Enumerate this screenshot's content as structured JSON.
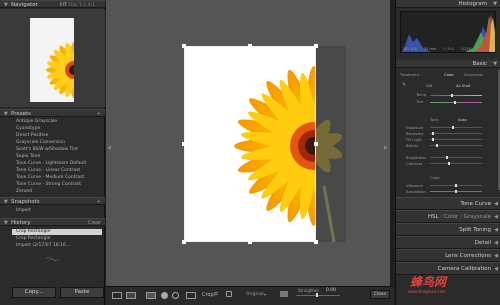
{
  "navigator": {
    "title": "Navigator",
    "zoom_options": [
      "FIT",
      "FILL",
      "1:1",
      "4:1"
    ]
  },
  "presets": {
    "title": "Presets",
    "items": [
      "Antique Grayscale",
      "Cyanotype",
      "Direct Positive",
      "Grayscale Conversion",
      "Scott's B&W w/Shadow Tint",
      "Sepia Tone",
      "Tone Curve - Lightroom Default",
      "Tone Curve - Linear Contrast",
      "Tone Curve - Medium Contrast",
      "Tone Curve - Strong Contrast",
      "Zeroed"
    ]
  },
  "snapshots": {
    "title": "Snapshots",
    "items": [
      "Import"
    ]
  },
  "history": {
    "title": "History",
    "clear_label": "Clear",
    "items": [
      "Crop Rectangle",
      "Crop Rectangle",
      "Import (2/17/07 16:16..."
    ]
  },
  "buttons": {
    "copy": "Copy...",
    "paste": "Paste",
    "close": "Close"
  },
  "toolbar": {
    "crop_label": "Crop:",
    "aspect_value": "Original",
    "straighten_label": "Straighten",
    "angle_value": "0.00"
  },
  "histogram": {
    "title": "Histogram",
    "info": [
      "ISO 100",
      "35 mm",
      "f / 5.0",
      "1/125"
    ]
  },
  "basic": {
    "title": "Basic",
    "treatment_label": "Treatment :",
    "color_option": "Color",
    "grayscale_option": "Grayscale",
    "wb_label": "WB :",
    "wb_value": "As Shot",
    "temp_label": "Temp",
    "tint_label": "Tint",
    "tone_label": "Tone",
    "auto_label": "Auto",
    "exposure_label": "Exposure",
    "recovery_label": "Recovery",
    "fill_light_label": "Fill Light",
    "blacks_label": "Blacks",
    "brightness_label": "Brightness",
    "contrast_label": "Contrast",
    "presence_label": "Color",
    "vibrance_label": "Vibrance",
    "saturation_label": "Saturation"
  },
  "panels": {
    "tone_curve": "Tone Curve",
    "hsl": "HSL",
    "color": "Color",
    "grayscale": "Grayscale",
    "split_toning": "Split Toning",
    "detail": "Detail",
    "lens_corrections": "Lens Corrections",
    "camera_calibration": "Camera Calibration"
  },
  "watermark": {
    "text": "蜂鸟网",
    "url": "www.fengniao.com"
  },
  "colors": {
    "panel_bg": "#2b2b2b",
    "canvas_bg": "#555555",
    "petal": "#f5b400",
    "center": "#3a1a08"
  }
}
